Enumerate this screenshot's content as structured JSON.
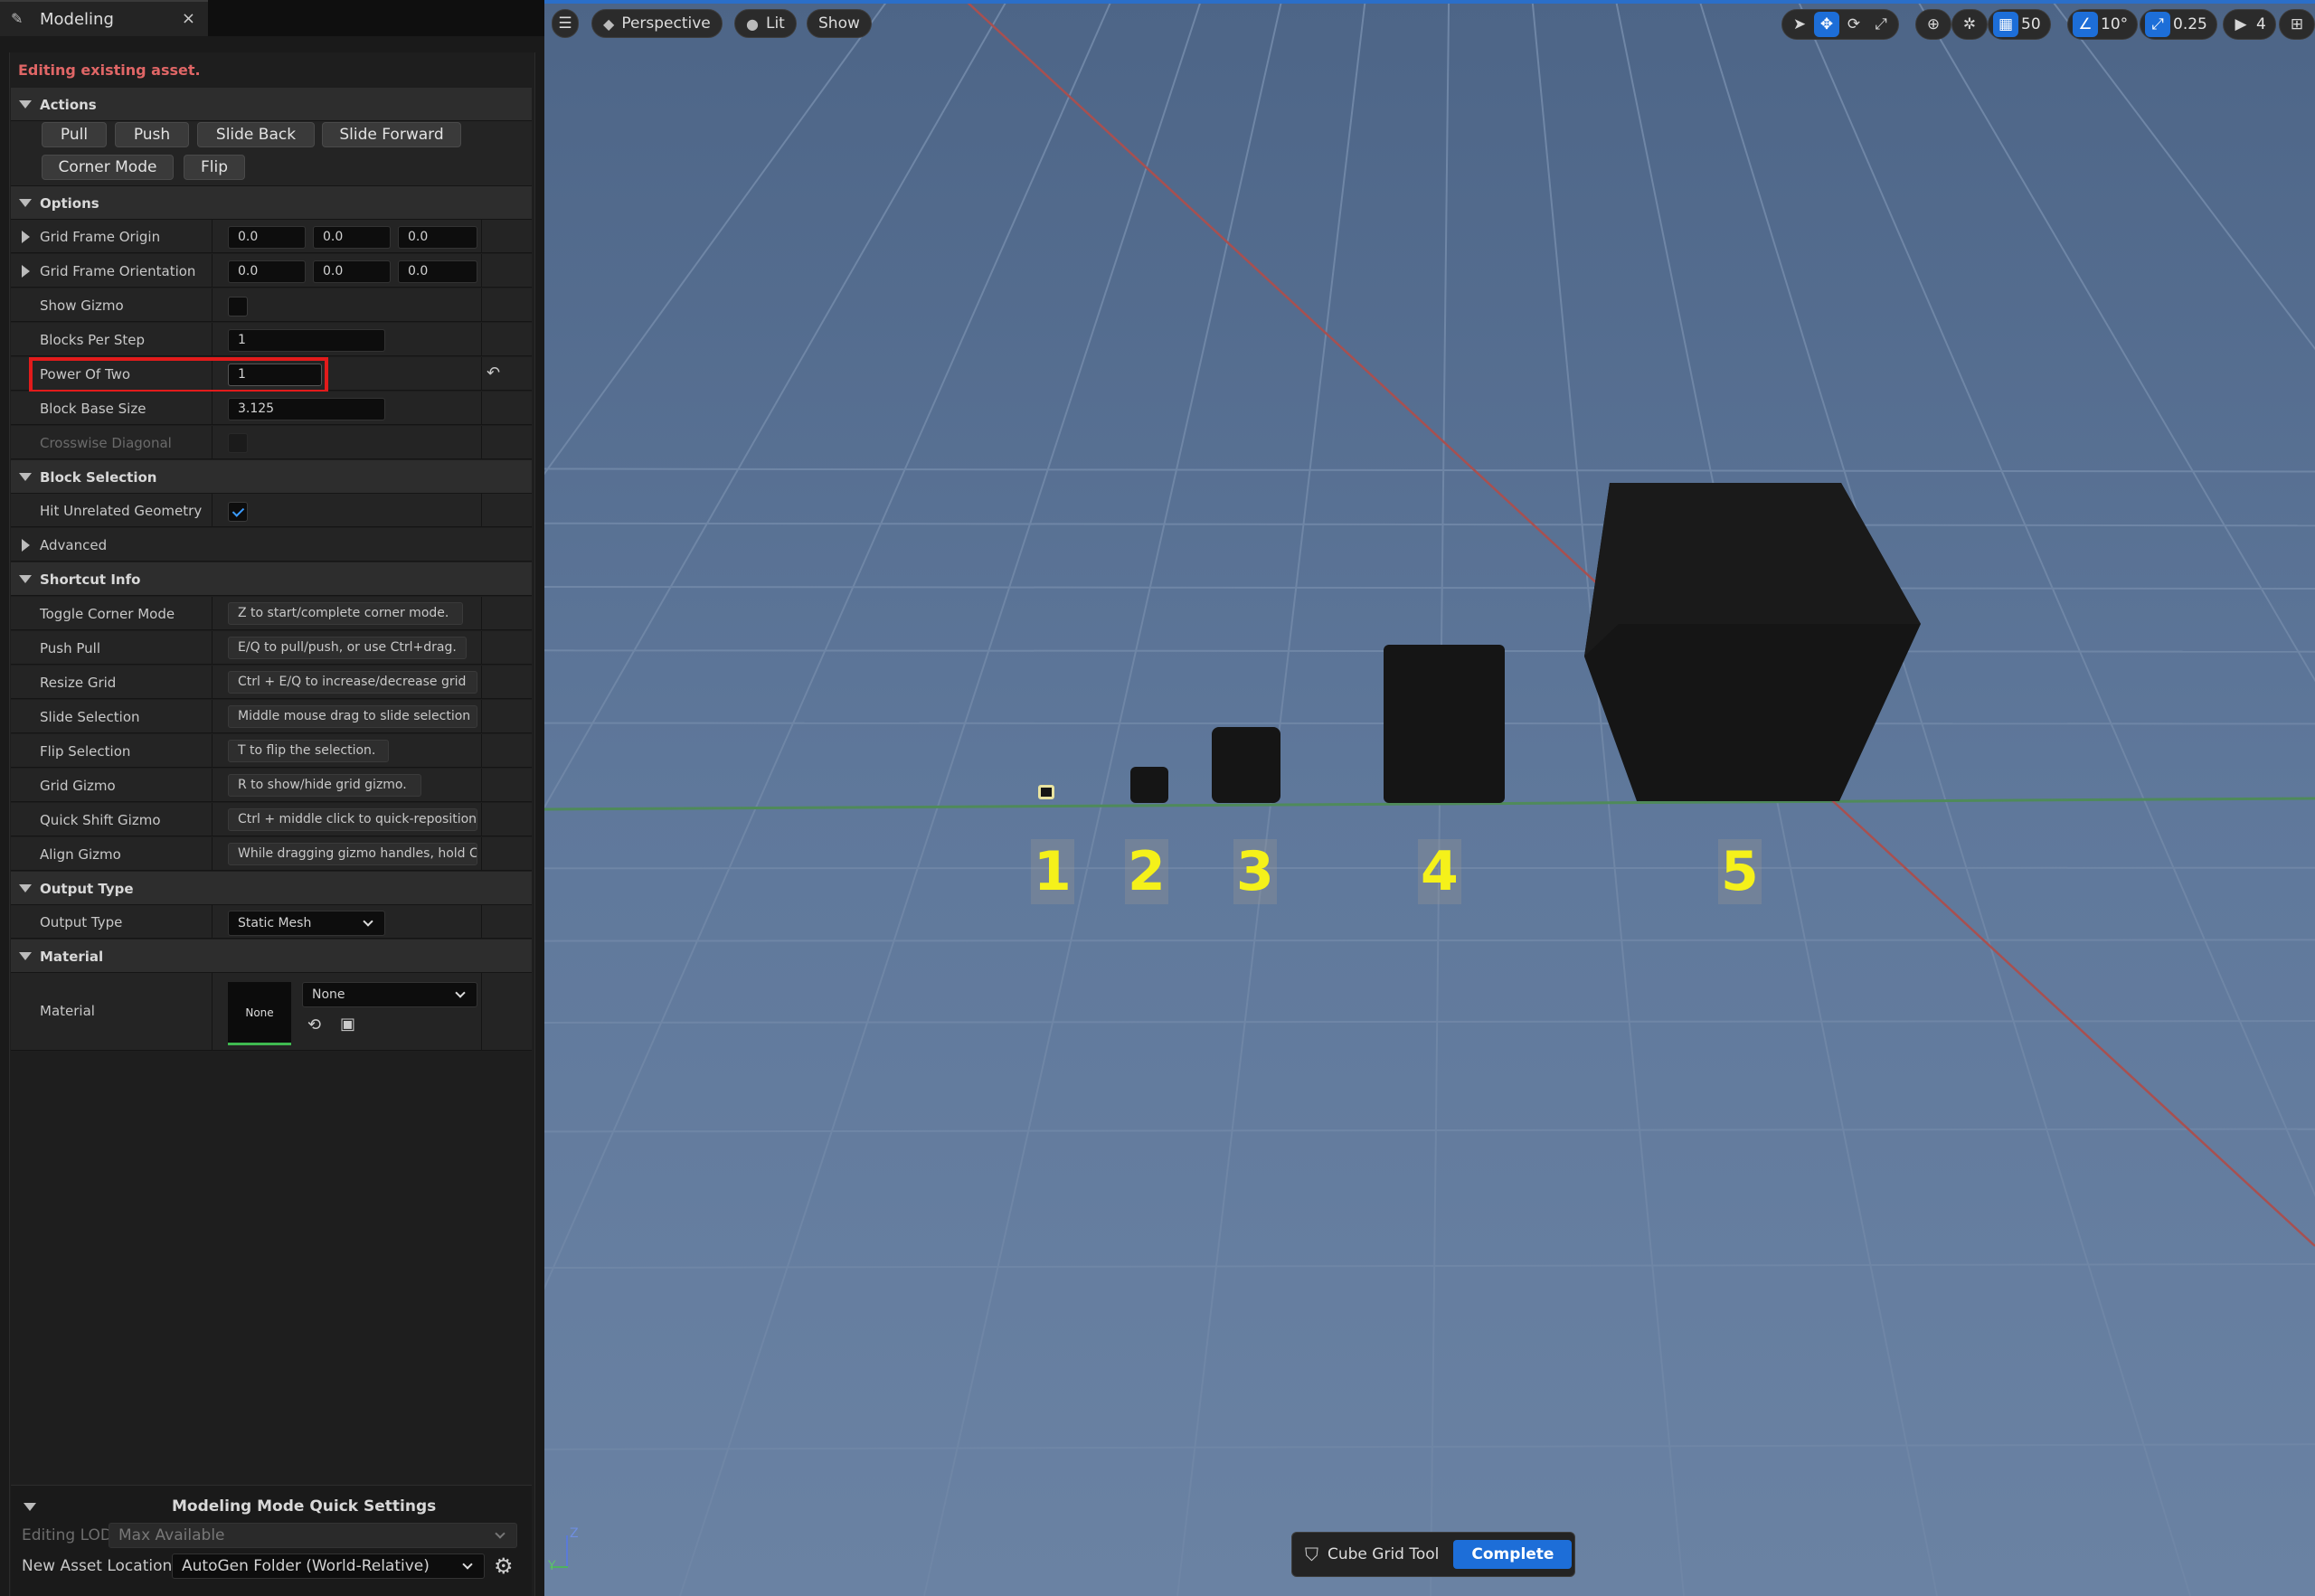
{
  "tab": {
    "title": "Modeling",
    "close": "×"
  },
  "warning": "Editing existing asset.",
  "sections": {
    "actions": "Actions",
    "options": "Options",
    "block_selection": "Block Selection",
    "advanced": "Advanced",
    "shortcut_info": "Shortcut Info",
    "output_type": "Output Type",
    "material": "Material"
  },
  "actions": {
    "pull": "Pull",
    "push": "Push",
    "slide_back": "Slide Back",
    "slide_forward": "Slide Forward",
    "corner_mode": "Corner Mode",
    "flip": "Flip"
  },
  "options": {
    "grid_frame_origin": {
      "label": "Grid Frame Origin",
      "x": "0.0",
      "y": "0.0",
      "z": "0.0"
    },
    "grid_frame_orientation": {
      "label": "Grid Frame Orientation",
      "x": "0.0",
      "y": "0.0",
      "z": "0.0"
    },
    "show_gizmo": {
      "label": "Show Gizmo",
      "checked": false
    },
    "blocks_per_step": {
      "label": "Blocks Per Step",
      "value": "1"
    },
    "power_of_two": {
      "label": "Power Of Two",
      "value": "1"
    },
    "block_base_size": {
      "label": "Block Base Size",
      "value": "3.125"
    },
    "crosswise_diagonal": {
      "label": "Crosswise Diagonal",
      "checked": false
    }
  },
  "block_selection": {
    "hit_unrelated_geometry": {
      "label": "Hit Unrelated Geometry",
      "checked": true
    }
  },
  "shortcuts": [
    {
      "label": "Toggle Corner Mode",
      "text": "Z to start/complete corner mode."
    },
    {
      "label": "Push Pull",
      "text": "E/Q to pull/push, or use Ctrl+drag."
    },
    {
      "label": "Resize Grid",
      "text": "Ctrl + E/Q to increase/decrease grid"
    },
    {
      "label": "Slide Selection",
      "text": "Middle mouse drag to slide selection"
    },
    {
      "label": "Flip Selection",
      "text": "T to flip the selection."
    },
    {
      "label": "Grid Gizmo",
      "text": "R to show/hide grid gizmo."
    },
    {
      "label": "Quick Shift Gizmo",
      "text": "Ctrl + middle click to quick-reposition"
    },
    {
      "label": "Align Gizmo",
      "text": "While dragging gizmo handles, hold Ctrl"
    }
  ],
  "output": {
    "label": "Output Type",
    "value": "Static Mesh"
  },
  "material": {
    "label": "Material",
    "thumb": "None",
    "value": "None"
  },
  "quick_settings": {
    "title": "Modeling Mode Quick Settings",
    "editing_lod_label": "Editing LOD",
    "editing_lod_value": "Max Available",
    "new_asset_label": "New Asset Location",
    "new_asset_value": "AutoGen Folder (World-Relative)"
  },
  "viewport": {
    "perspective": "Perspective",
    "lit": "Lit",
    "show": "Show",
    "grid_snap": "50",
    "rot_snap": "10°",
    "scale_snap": "0.25",
    "camera_speed": "4",
    "labels": [
      "1",
      "2",
      "3",
      "4",
      "5"
    ],
    "axis_y": "Y",
    "axis_z": "Z"
  },
  "tool": {
    "name": "Cube Grid Tool",
    "complete": "Complete"
  },
  "colors": {
    "accent": "#1d6ed8",
    "highlight": "#e21b1b",
    "label": "#f5f11a",
    "warning": "#e06666"
  }
}
